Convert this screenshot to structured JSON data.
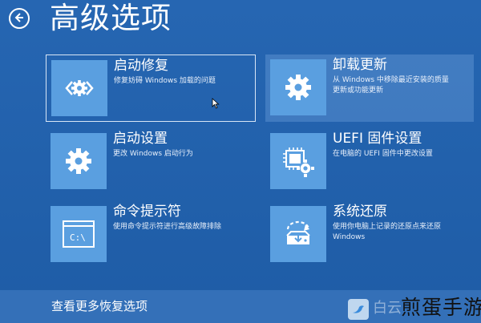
{
  "header": {
    "title": "高级选项",
    "back_icon": "arrow-left-icon"
  },
  "tiles": [
    {
      "title": "启动修复",
      "desc": "修复妨碍 Windows 加载的问题",
      "icon": "code-gear-icon"
    },
    {
      "title": "卸载更新",
      "desc": "从 Windows 中移除最近安装的质量\n更新或功能更新",
      "icon": "gear-icon"
    },
    {
      "title": "启动设置",
      "desc": "更改 Windows 启动行为",
      "icon": "gear-icon"
    },
    {
      "title": "UEFI 固件设置",
      "desc": "在电脑的 UEFI 固件中更改设置",
      "icon": "chip-gear-icon"
    },
    {
      "title": "命令提示符",
      "desc": "使用命令提示符进行高级故障排除",
      "icon": "command-prompt-icon"
    },
    {
      "title": "系统还原",
      "desc": "使用你电脑上记录的还原点来还原\nWindows",
      "icon": "system-restore-icon"
    }
  ],
  "footer": {
    "link": "查看更多恢复选项"
  },
  "watermark": {
    "faint": "白云",
    "text": "煎蛋手游"
  },
  "cursor_prompt": "C:\\"
}
